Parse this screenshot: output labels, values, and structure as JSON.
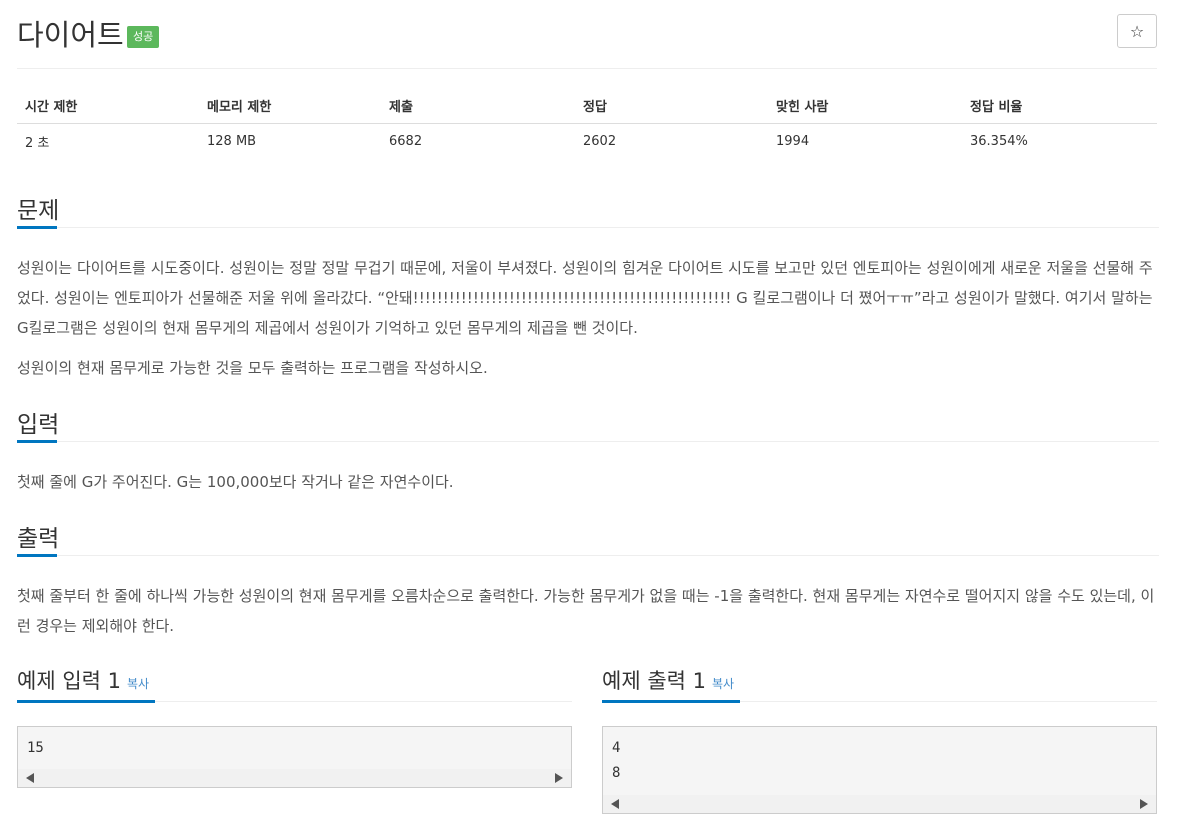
{
  "problem": {
    "title": "다이어트",
    "status_badge": "성공",
    "star_label": "☆"
  },
  "info": {
    "headers": [
      "시간 제한",
      "메모리 제한",
      "제출",
      "정답",
      "맞힌 사람",
      "정답 비율"
    ],
    "values": [
      "2 초",
      "128 MB",
      "6682",
      "2602",
      "1994",
      "36.354%"
    ]
  },
  "sections": {
    "problem_title": "문제",
    "problem_text_1": "성원이는 다이어트를 시도중이다. 성원이는 정말 정말 무겁기 때문에, 저울이 부셔졌다. 성원이의 힘겨운 다이어트 시도를 보고만 있던 엔토피아는 성원이에게 새로운 저울을 선물해 주었다. 성원이는 엔토피아가 선물해준 저울 위에 올라갔다. “안돼!!!!!!!!!!!!!!!!!!!!!!!!!!!!!!!!!!!!!!!!!!!!!!!!!!!!! G 킬로그램이나 더 쪘어ㅜㅠ”라고 성원이가 말했다. 여기서 말하는 G킬로그램은 성원이의 현재 몸무게의 제곱에서 성원이가 기억하고 있던 몸무게의 제곱을 뺀 것이다.",
    "problem_text_2": "성원이의 현재 몸무게로 가능한 것을 모두 출력하는 프로그램을 작성하시오.",
    "input_title": "입력",
    "input_text": "첫째 줄에 G가 주어진다. G는 100,000보다 작거나 같은 자연수이다.",
    "output_title": "출력",
    "output_text": "첫째 줄부터 한 줄에 하나씩 가능한 성원이의 현재 몸무게를 오름차순으로 출력한다. 가능한 몸무게가 없을 때는 -1을 출력한다. 현재 몸무게는 자연수로 떨어지지 않을 수도 있는데, 이런 경우는 제외해야 한다."
  },
  "examples": {
    "input_title": "예제 입력 1",
    "output_title": "예제 출력 1",
    "copy_label": "복사",
    "input_lines": [
      "15"
    ],
    "output_lines": [
      "4",
      "8"
    ]
  },
  "colors": {
    "badge_green": "#5cb85c",
    "accent_blue": "#0076c0",
    "link_blue": "#428bca"
  }
}
